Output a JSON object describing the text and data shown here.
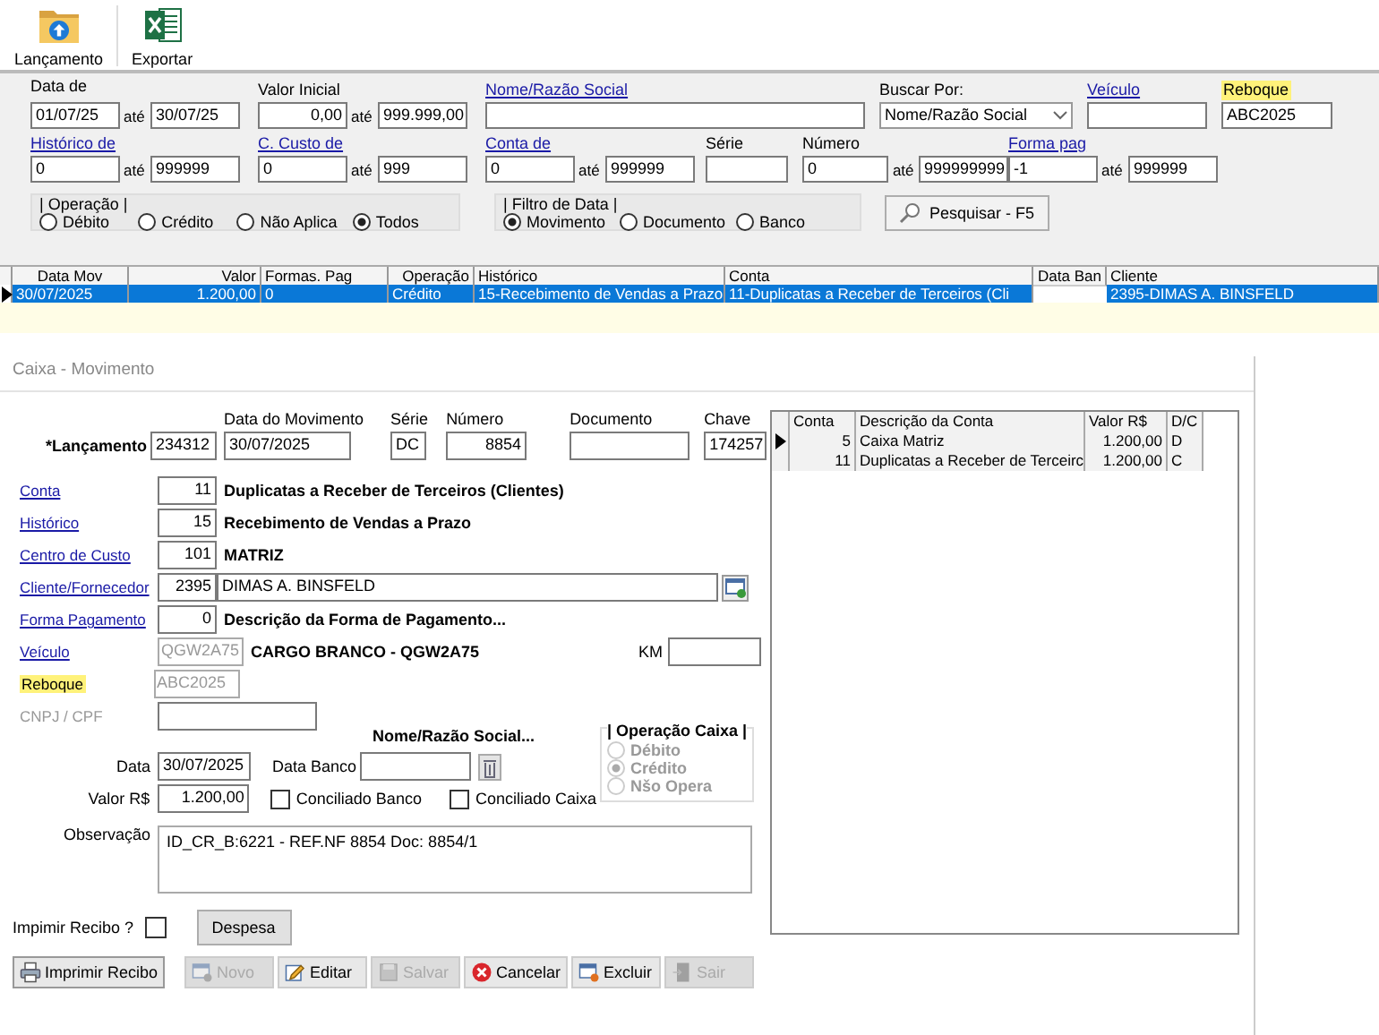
{
  "toolbar": [
    {
      "kind": "folder",
      "label": "Lançamento"
    },
    {
      "kind": "spreadsheet",
      "label": "Exportar"
    }
  ],
  "filter_rows": [
    [
      {
        "kind": "range",
        "label": "Data de",
        "link": false,
        "from": "01/07/25",
        "to_label": "até",
        "to": "30/07/25"
      },
      {
        "kind": "money_range",
        "label": "Valor Inicial",
        "link": false,
        "from": "0,00",
        "to_label": "até",
        "to": "999.999,00"
      },
      {
        "kind": "text",
        "label": "Nome/Razão Social",
        "link": true
      },
      {
        "kind": "select",
        "label": "Buscar Por:",
        "link": false,
        "value": "Nome/Razão Social"
      },
      {
        "kind": "text",
        "label": "Veículo",
        "link": true
      },
      {
        "kind": "text",
        "label": "Reboque",
        "link": false,
        "highlighted": true,
        "value": "ABC2025"
      }
    ],
    [
      {
        "kind": "range",
        "label": "Histórico de",
        "link": true,
        "from": "0",
        "to_label": "até",
        "to": "999999"
      },
      {
        "kind": "range",
        "label": "C. Custo de",
        "link": true,
        "from": "0",
        "to_label": "até",
        "to": "999"
      },
      {
        "kind": "range",
        "label": "Conta de",
        "link": true,
        "from": "0",
        "to_label": "até",
        "to": "999999"
      },
      {
        "kind": "text",
        "label": "Série",
        "link": false
      },
      {
        "kind": "range",
        "label": "Número",
        "link": false,
        "from": "0",
        "to_label": "até",
        "to": "999999999"
      },
      {
        "kind": "range",
        "label": "Forma pag",
        "link": true,
        "from": "-1",
        "to_label": "até",
        "to": "999999"
      }
    ]
  ],
  "filter_groups": [
    {
      "title": "| Operação |",
      "options": [
        {
          "label": "Débito",
          "selected": false
        },
        {
          "label": "Crédito",
          "selected": false
        },
        {
          "label": "Não Aplica",
          "selected": false
        },
        {
          "label": "Todos",
          "selected": true
        }
      ]
    },
    {
      "title": "| Filtro de Data |",
      "options": [
        {
          "label": "Movimento",
          "selected": true
        },
        {
          "label": "Documento",
          "selected": false
        },
        {
          "label": "Banco",
          "selected": false
        }
      ]
    }
  ],
  "search_button": "Pesquisar - F5",
  "table": {
    "columns": [
      "Data Mov",
      "Valor",
      "Formas. Pag",
      "Operação",
      "Histórico",
      "Conta",
      "Data Ban",
      "Cliente"
    ],
    "rows": [
      {
        "selected": true,
        "cells": [
          "30/07/2025",
          "1.200,00",
          "0",
          "Crédito",
          "15-Recebimento de Vendas a Prazo",
          "11-Duplicatas a Receber de Terceiros (Cli",
          null,
          "2395-DIMAS A. BINSFELD"
        ]
      }
    ]
  },
  "form": {
    "title": "Caixa - Movimento",
    "header_fields": [
      {
        "kind": "key",
        "label": "*Lançamento",
        "value": "234312"
      },
      {
        "kind": "plain",
        "label": "Data do Movimento",
        "value": "30/07/2025"
      },
      {
        "kind": "plain",
        "label": "Série",
        "value": "DC"
      },
      {
        "kind": "number",
        "label": "Número",
        "value": "8854"
      },
      {
        "kind": "plain",
        "label": "Documento"
      },
      {
        "kind": "number",
        "label": "Chave",
        "value": "174257"
      }
    ],
    "lookups": [
      {
        "kind": "description",
        "label": "Conta",
        "link": true,
        "code": "11",
        "description": "Duplicatas a Receber de Terceiros (Clientes)"
      },
      {
        "kind": "description",
        "label": "Histórico",
        "link": true,
        "code": "15",
        "description": "Recebimento de Vendas a Prazo"
      },
      {
        "kind": "description",
        "label": "Centro de Custo",
        "link": true,
        "code": "101",
        "description": "MATRIZ"
      },
      {
        "kind": "name",
        "label": "Cliente/Fornecedor",
        "link": true,
        "code": "2395",
        "name": "DIMAS A. BINSFELD"
      },
      {
        "kind": "description",
        "label": "Forma Pagamento",
        "link": true,
        "code": "0",
        "description": "Descrição da Forma de Pagamento..."
      },
      {
        "kind": "description",
        "label": "Veículo",
        "link": true,
        "code": "QGW2A75",
        "disabled": true,
        "description": "CARGO BRANCO - QGW2A75",
        "extra_label": "KM"
      },
      {
        "kind": "code_only",
        "label": "Reboque",
        "link": false,
        "highlighted": true,
        "code": "ABC2025",
        "disabled": true
      },
      {
        "kind": "wide_field",
        "label": "CNPJ / CPF",
        "link": false,
        "label_disabled": true
      }
    ],
    "social_caption": "Nome/Razão Social...",
    "date_row": [
      {
        "label": "Data",
        "value": "30/07/2025"
      },
      {
        "label": "Data Banco"
      }
    ],
    "value_row": {
      "label": "Valor R$",
      "value": "1.200,00"
    },
    "reconciled": [
      {
        "label": "Conciliado Banco",
        "checked": false
      },
      {
        "label": "Conciliado Caixa",
        "checked": false
      }
    ],
    "operation": {
      "title": "| Operação Caixa |",
      "disabled": true,
      "options": [
        {
          "label": "Débito",
          "selected": false
        },
        {
          "label": "Crédito",
          "selected": true
        },
        {
          "label": "Nšo Opera",
          "selected": false
        }
      ]
    },
    "note": {
      "label": "Observação",
      "value": "ID_CR_B:6221 - REF.NF 8854 Doc: 8854/1"
    },
    "print_receipt": {
      "label": "Impimir Recibo ?",
      "checked": false
    },
    "expense_button": "Despesa",
    "actions": [
      {
        "kind": "print",
        "label": "Imprimir Recibo",
        "disabled": false
      },
      {
        "kind": "new",
        "label": "Novo",
        "disabled": true
      },
      {
        "kind": "edit",
        "label": "Editar",
        "disabled": false
      },
      {
        "kind": "save",
        "label": "Salvar",
        "disabled": true
      },
      {
        "kind": "cancel",
        "label": "Cancelar",
        "disabled": false
      },
      {
        "kind": "delete",
        "label": "Excluir",
        "disabled": false
      },
      {
        "kind": "exit",
        "label": "Sair",
        "disabled": true
      }
    ],
    "entries": {
      "columns": [
        "Conta",
        "Descrição da Conta",
        "Valor R$",
        "D/C"
      ],
      "rows": [
        {
          "current": true,
          "cells": [
            "5",
            "Caixa Matriz",
            "1.200,00",
            "D"
          ]
        },
        {
          "current": false,
          "cells": [
            "11",
            "Duplicatas a Receber de Terceirc",
            "1.200,00",
            "C"
          ]
        }
      ]
    }
  }
}
